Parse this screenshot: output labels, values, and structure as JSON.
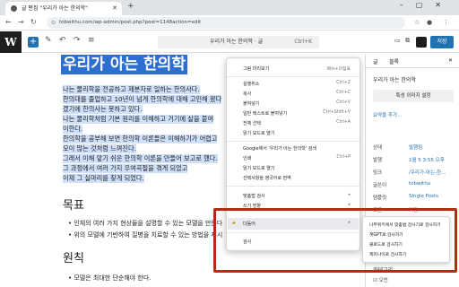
{
  "browser": {
    "tab_title": "글 편집 \"우리가 아는 한의학\"",
    "address": "tobwithu.com/wp-admin/post.php?post=1148action=edit"
  },
  "wp": {
    "logo": "W",
    "doc_title": "우리가 아는 한의학 · 글",
    "doc_shortcut": "Ctrl+K",
    "save_label": "저장"
  },
  "post": {
    "title": "우리가 아는 한의학",
    "paragraphs": [
      "나는 물리학을 전공하고 제분자로 일하는 한의사다.",
      "한의대를 졸업하고 10년이 넘게 한의학에 대해 고민해 왔다",
      "겠기에 한의사는 못하고 있다.",
      "나는 물리학처럼 기본 원리를 이해하고 거기에 살을 붙여",
      "이한다.",
      "한의학을 공부해 보면 한의학 이론들은 이해하기가 어렵고",
      "모이 많는 것처럼 느껴진다.",
      "그래서 이해 앞기 쉬운 한의학 이론을 만들어 보고로 했다.",
      "그 과정에서 여러 가지 우여곡절을 겪게 되었고",
      "이제 그 실마리를 찾게 되었다."
    ],
    "h2_goal": "목표",
    "goal_bullets": [
      "인체의 여러 가지 현상들을 설명할 수 있는 모델을 만든다",
      "위의 모델에 기반하여 질병을 치료할 수 있는 방법을 제시"
    ],
    "h2_principle": "원칙",
    "principle_bullets": [
      "모델은 최대한 단순해야 한다."
    ]
  },
  "sidebar": {
    "tab_post": "글",
    "tab_block": "블록",
    "post_title": "우리가 아는 한의학",
    "featured_button": "특성 이미지 설정",
    "excerpt": "요약을 추가...",
    "rows": [
      {
        "label": "상태",
        "value": "발행됨"
      },
      {
        "label": "발행",
        "value": "1월 5 3:55 오후"
      },
      {
        "label": "링크",
        "value": "/우리가-아는-한…"
      },
      {
        "label": "글쓴이",
        "value": "tobwithu"
      },
      {
        "label": "템플릿",
        "value": "Single Posts"
      },
      {
        "label": "토론",
        "value": "켜짐"
      },
      {
        "label": "형식",
        "value": "표준"
      }
    ],
    "categories_label": "카테고리",
    "checkbox_label": "오빈"
  },
  "context_menu": {
    "items": [
      {
        "label": "그림 미리보기",
        "shortcut": "Win+마침표"
      },
      {
        "label": "실행취소",
        "shortcut": "Ctrl+Z"
      },
      {
        "label": "복사",
        "shortcut": "Ctrl+C"
      },
      {
        "label": "붙여넣기",
        "shortcut": "Ctrl+V"
      },
      {
        "label": "일반 텍스트로 붙여넣기",
        "shortcut": "Ctrl+Shift+V"
      },
      {
        "label": "전체 선택",
        "shortcut": "Ctrl+A"
      },
      {
        "label": "읽기 모드로 열기",
        "shortcut": ""
      },
      {
        "label": "Google에서 '우리가 아는 한의학' 검색",
        "shortcut": ""
      },
      {
        "label": "인쇄",
        "shortcut": "Ctrl+P"
      },
      {
        "label": "읽기 모드로 열기",
        "shortcut": ""
      },
      {
        "label": "선택사항을 영국어로 번역",
        "shortcut": ""
      },
      {
        "label": "맞춤법 검사",
        "shortcut": "▸"
      },
      {
        "label": "쓰기 방향",
        "shortcut": "▸"
      },
      {
        "label": "다듬어",
        "shortcut": "▸"
      },
      {
        "label": "검사",
        "shortcut": ""
      }
    ]
  },
  "submenu": {
    "items": [
      "나무위키에서 맞춤법 검사기로 검사하기",
      "챗GPT로 검사하기",
      "클로드로 검사하기",
      "제미나이로 검사하기"
    ]
  }
}
